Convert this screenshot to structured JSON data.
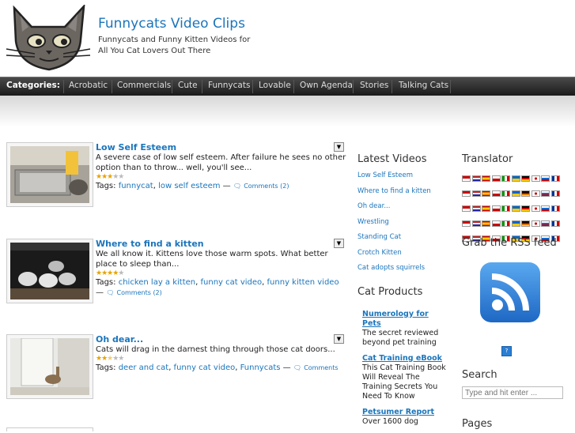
{
  "header": {
    "title": "Funnycats Video Clips",
    "desc_line1": "Funnycats and Funny Kitten Videos for",
    "desc_line2": "All You Cat Lovers Out There"
  },
  "categories": {
    "label": "Categories:",
    "items": [
      "Acrobatic",
      "Commercials",
      "Cute",
      "Funnycats",
      "Lovable",
      "Own Agenda",
      "Stories",
      "Talking Cats"
    ]
  },
  "posts": [
    {
      "title": "Low Self Esteem",
      "excerpt": "A severe case of low self esteem.  After failure he sees no other option than to throw... well, you'll see...",
      "rating": 3,
      "tags_label": "Tags:",
      "tags": [
        "funnycat",
        "low self esteem"
      ],
      "comments": "Comments (2)"
    },
    {
      "title": "Where to find a kitten",
      "excerpt": "We all know it.  Kittens love those warm spots.  What better place to sleep than...",
      "rating": 4,
      "tags_label": "Tags:",
      "tags": [
        "chicken lay a kitten",
        "funny cat video",
        "funny kitten video"
      ],
      "comments": "Comments (2)"
    },
    {
      "title": "Oh dear...",
      "excerpt": "Cats will drag in the darnest thing through those cat doors...",
      "rating": 2.5,
      "tags_label": "Tags:",
      "tags": [
        "deer and cat",
        "funny cat video",
        "Funnycats"
      ],
      "comments": "Comments"
    }
  ],
  "latest_videos": {
    "heading": "Latest Videos",
    "items": [
      "Low Self Esteem",
      "Where to find a kitten",
      "Oh dear...",
      "Wrestling",
      "Standing Cat",
      "Crotch Kitten",
      "Cat adopts squirrels"
    ]
  },
  "cat_products": {
    "heading": "Cat Products",
    "items": [
      {
        "title": "Numerology for Pets",
        "desc": "The secret reviewed beyond pet training"
      },
      {
        "title": "Cat Training eBook",
        "desc": "This Cat Training Book Will Reveal The Training Secrets You Need To Know"
      },
      {
        "title": "Petsumer Report",
        "desc": "Over 1600 dog"
      }
    ]
  },
  "translator": {
    "heading": "Translator"
  },
  "rss": {
    "heading": "Grab the RSS feed",
    "small_badge": "?"
  },
  "search": {
    "heading": "Search",
    "placeholder": "Type and hit enter ..."
  },
  "pages": {
    "heading": "Pages"
  },
  "colors": {
    "link": "#1b75bc",
    "rss_blue": "#2a7fd4",
    "star": "#e7a400"
  }
}
